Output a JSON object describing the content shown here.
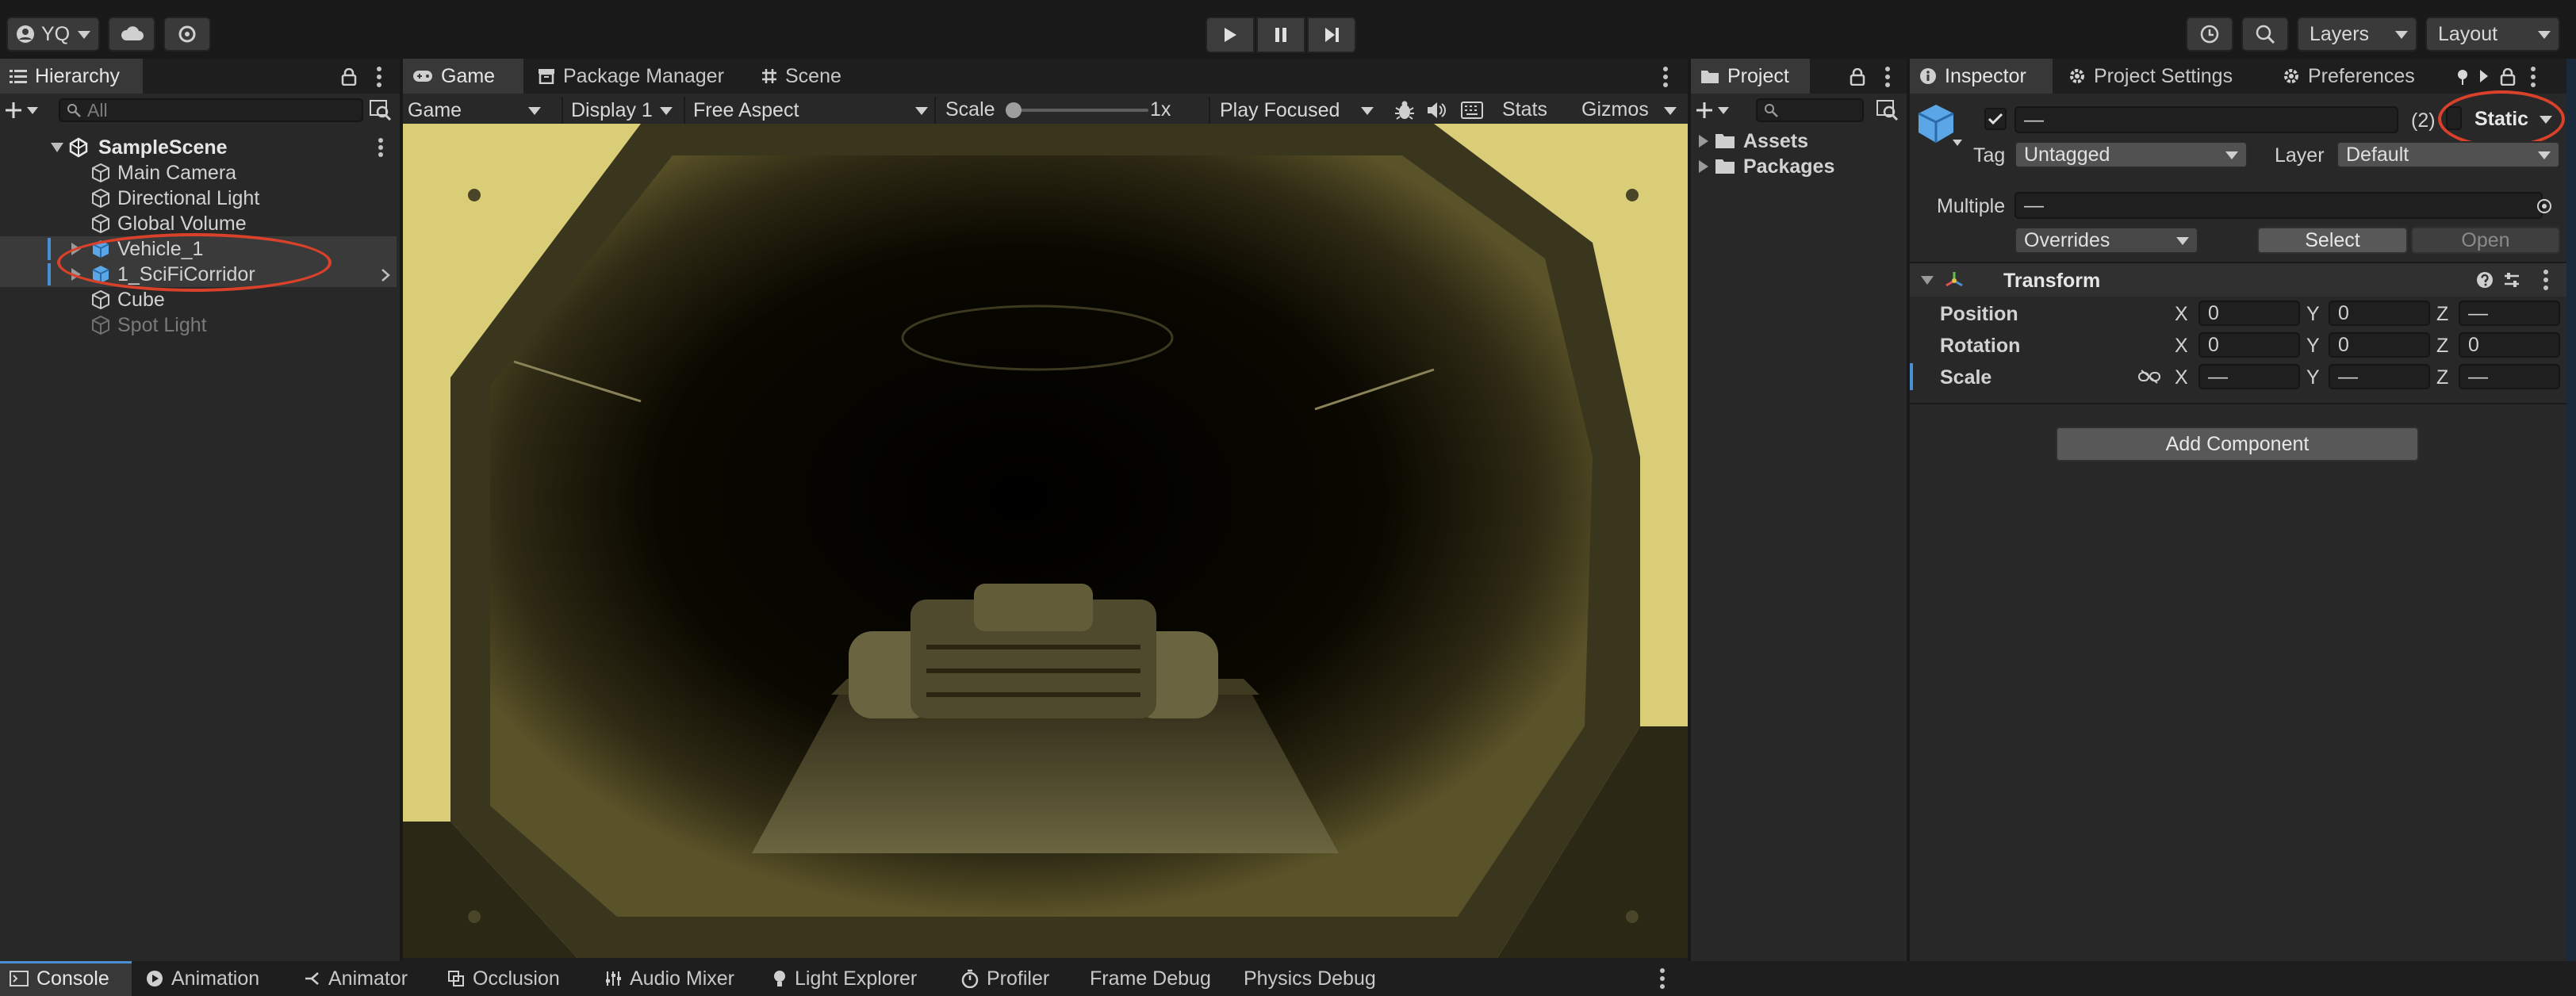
{
  "toolbar": {
    "account_label": "YQ",
    "layers_label": "Layers",
    "layout_label": "Layout"
  },
  "hierarchy": {
    "tab_label": "Hierarchy",
    "search_placeholder": "All",
    "scene_name": "SampleScene",
    "items": [
      {
        "label": "Main Camera"
      },
      {
        "label": "Directional Light"
      },
      {
        "label": "Global Volume"
      },
      {
        "label": "Vehicle_1"
      },
      {
        "label": "1_SciFiCorridor"
      },
      {
        "label": "Cube"
      },
      {
        "label": "Spot Light"
      }
    ]
  },
  "center": {
    "tabs": [
      "Game",
      "Package Manager",
      "Scene"
    ],
    "game_dropdown": "Game",
    "display_dropdown": "Display 1",
    "aspect_dropdown": "Free Aspect",
    "scale_label": "Scale",
    "scale_value": "1x",
    "scale_slider_fraction": 0.0,
    "play_mode_dropdown": "Play Focused",
    "stats_label": "Stats",
    "gizmos_label": "Gizmos"
  },
  "project": {
    "tab_label": "Project",
    "items": [
      {
        "label": "Assets"
      },
      {
        "label": "Packages"
      }
    ]
  },
  "inspector": {
    "tabs": [
      "Inspector",
      "Project Settings",
      "Preferences"
    ],
    "name_value": "—",
    "count_label": "(2)",
    "static_label": "Static",
    "tag_label": "Tag",
    "tag_value": "Untagged",
    "layer_label": "Layer",
    "layer_value": "Default",
    "multiple_label": "Multiple",
    "multiple_value": "—",
    "overrides_label": "Overrides",
    "select_label": "Select",
    "open_label": "Open",
    "transform": {
      "title": "Transform",
      "rows": [
        {
          "label": "Position",
          "x": "0",
          "y": "0",
          "z": "—"
        },
        {
          "label": "Rotation",
          "x": "0",
          "y": "0",
          "z": "0"
        },
        {
          "label": "Scale",
          "x": "—",
          "y": "—",
          "z": "—"
        }
      ],
      "axis_x": "X",
      "axis_y": "Y",
      "axis_z": "Z"
    },
    "add_component_label": "Add Component"
  },
  "bottom": {
    "tabs": [
      "Console",
      "Animation",
      "Animator",
      "Occlusion",
      "Audio Mixer",
      "Light Explorer",
      "Profiler",
      "Frame Debug",
      "Physics Debug"
    ]
  },
  "colors": {
    "accent_blue": "#4a8fd4",
    "annotation_red": "#d9412a",
    "game_view_tint": "#e8dc88"
  }
}
